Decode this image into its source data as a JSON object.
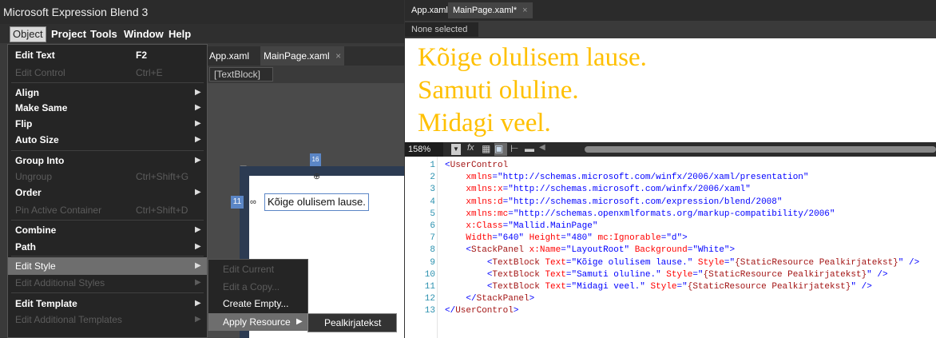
{
  "left": {
    "title": "Microsoft Expression Blend 3",
    "menu": [
      "Object",
      "Project",
      "Tools",
      "Window",
      "Help"
    ],
    "dropdown": [
      {
        "label": "Edit Text",
        "shortcut": "F2",
        "enabled": true
      },
      {
        "label": "Edit Control",
        "shortcut": "Ctrl+E",
        "enabled": false
      },
      {
        "label": "Align",
        "enabled": true,
        "arrow": true
      },
      {
        "label": "Make Same",
        "enabled": true,
        "arrow": true
      },
      {
        "label": "Flip",
        "enabled": true,
        "arrow": true
      },
      {
        "label": "Auto Size",
        "enabled": true,
        "arrow": true
      },
      {
        "label": "Group Into",
        "enabled": true,
        "arrow": true
      },
      {
        "label": "Ungroup",
        "shortcut": "Ctrl+Shift+G",
        "enabled": false
      },
      {
        "label": "Order",
        "enabled": true,
        "arrow": true
      },
      {
        "label": "Pin Active Container",
        "shortcut": "Ctrl+Shift+D",
        "enabled": false
      },
      {
        "label": "Combine",
        "enabled": true,
        "arrow": true
      },
      {
        "label": "Path",
        "enabled": true,
        "arrow": true
      },
      {
        "label": "Edit Style",
        "enabled": true,
        "arrow": true,
        "highlighted": true
      },
      {
        "label": "Edit Additional Styles",
        "enabled": false,
        "arrow": true
      },
      {
        "label": "Edit Template",
        "enabled": true,
        "arrow": true
      },
      {
        "label": "Edit Additional Templates",
        "enabled": false,
        "arrow": true
      }
    ],
    "submenu": [
      {
        "label": "Edit Current",
        "enabled": false
      },
      {
        "label": "Edit a Copy...",
        "enabled": false
      },
      {
        "label": "Create Empty...",
        "enabled": true
      },
      {
        "label": "Apply Resource",
        "enabled": true,
        "arrow": true,
        "highlighted": true
      }
    ],
    "resource_item": "Pealkirjatekst",
    "design_tabs": [
      "App.xaml",
      "MainPage.xaml"
    ],
    "breadcrumb": "[TextBlock]",
    "selected_text": "Kõige olulisem lause.",
    "margin_left_label": "11",
    "margin_top_label": "16"
  },
  "right": {
    "tabs": [
      "App.xaml",
      "MainPage.xaml*"
    ],
    "status": "None selected",
    "preview_lines": [
      "Kõige olulisem lause.",
      "Samuti oluline.",
      "Midagi veel."
    ],
    "zoom": "158%",
    "code": [
      "<UserControl",
      "    xmlns=\"http://schemas.microsoft.com/winfx/2006/xaml/presentation\"",
      "    xmlns:x=\"http://schemas.microsoft.com/winfx/2006/xaml\"",
      "    xmlns:d=\"http://schemas.microsoft.com/expression/blend/2008\"",
      "    xmlns:mc=\"http://schemas.openxmlformats.org/markup-compatibility/2006\"",
      "    x:Class=\"Mallid.MainPage\"",
      "    Width=\"640\" Height=\"480\" mc:Ignorable=\"d\">",
      "    <StackPanel x:Name=\"LayoutRoot\" Background=\"White\">",
      "        <TextBlock Text=\"Kõige olulisem lause.\" Style=\"{StaticResource Pealkirjatekst}\" />",
      "        <TextBlock Text=\"Samuti oluline.\" Style=\"{StaticResource Pealkirjatekst}\" />",
      "        <TextBlock Text=\"Midagi veel.\" Style=\"{StaticResource Pealkirjatekst}\" />",
      "    </StackPanel>",
      "</UserControl>"
    ]
  },
  "colors": {
    "preview_text": "#ffc000",
    "highlight": "#6e6e6e",
    "artboard_frame": "#2c3b52"
  }
}
